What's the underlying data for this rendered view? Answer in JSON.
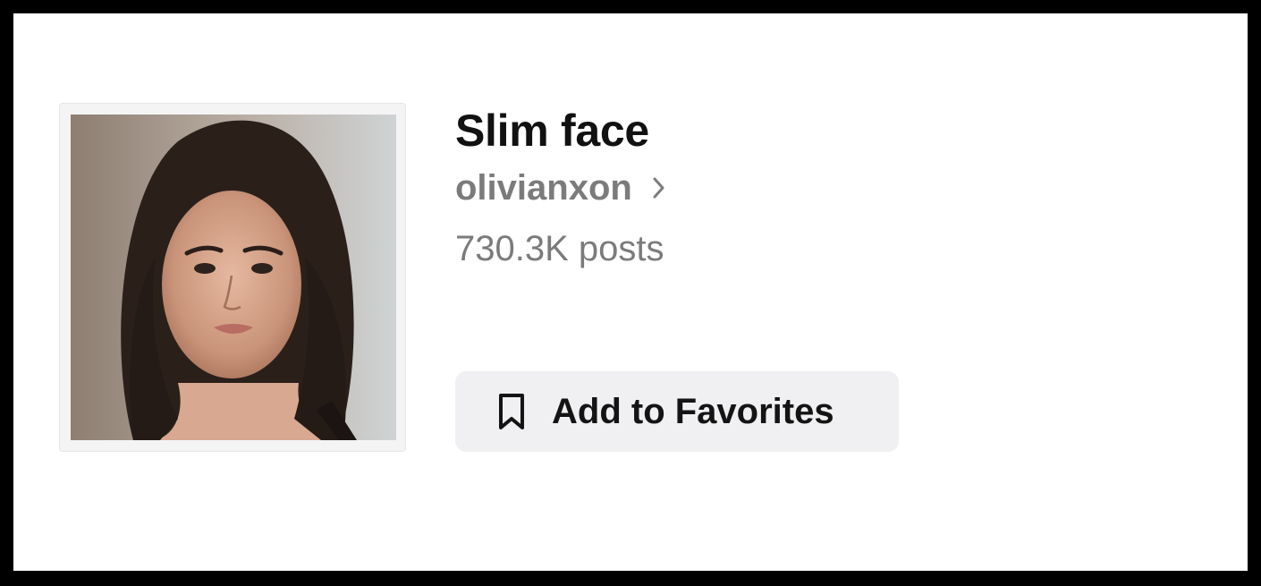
{
  "effect": {
    "title": "Slim face",
    "author": "olivianxon",
    "posts": "730.3K posts"
  },
  "actions": {
    "favorite_label": "Add to Favorites"
  },
  "icons": {
    "author_chevron": "chevron-right-icon",
    "favorite": "bookmark-icon"
  },
  "colors": {
    "title": "#111111",
    "secondary_text": "#7b7b7b",
    "button_bg": "#f0f0f2"
  }
}
